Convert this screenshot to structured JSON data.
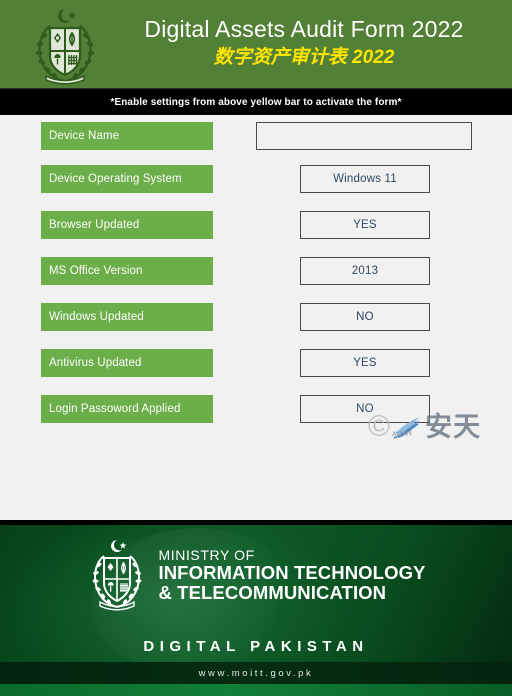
{
  "header": {
    "title": "Digital Assets Audit Form 2022",
    "subtitle": "数字资产审计表 2022",
    "emblem_icon": "pakistan-state-emblem-icon",
    "background_color": "#528036",
    "title_color": "#FFFFFF",
    "subtitle_color": "#FFE400"
  },
  "notice": {
    "text": "*Enable settings from above yellow bar to activate the form*",
    "background_color": "#000000",
    "text_color": "#FFFFFF"
  },
  "form": {
    "label_color": "#6CAE49",
    "value_border_color": "#4A4A4A",
    "value_text_color": "#2F4763",
    "rows": [
      {
        "label": "Device Name",
        "value": "",
        "input": true
      },
      {
        "label": "Device Operating System",
        "value": "Windows 11",
        "input": false
      },
      {
        "label": "Browser Updated",
        "value": "YES",
        "input": false
      },
      {
        "label": "MS Office Version",
        "value": "2013",
        "input": false
      },
      {
        "label": "Windows Updated",
        "value": "NO",
        "input": false
      },
      {
        "label": "Antivirus Updated",
        "value": "YES",
        "input": false
      },
      {
        "label": "Login Passoword Applied",
        "value": "NO",
        "input": false
      }
    ]
  },
  "watermark": {
    "copyright_symbol": "©",
    "brand": "ANTIY",
    "chinese": "安天",
    "logo_icon": "antiy-wing-logo-icon"
  },
  "footer": {
    "emblem_icon": "pakistan-state-emblem-icon",
    "ministry_line1": "MINISTRY OF",
    "ministry_line2": "INFORMATION TECHNOLOGY",
    "ministry_line3": "& TELECOMMUNICATION",
    "tagline": "DIGITAL PAKISTAN",
    "url": "www.moitt.gov.pk",
    "background_color": "#0A4D20"
  }
}
